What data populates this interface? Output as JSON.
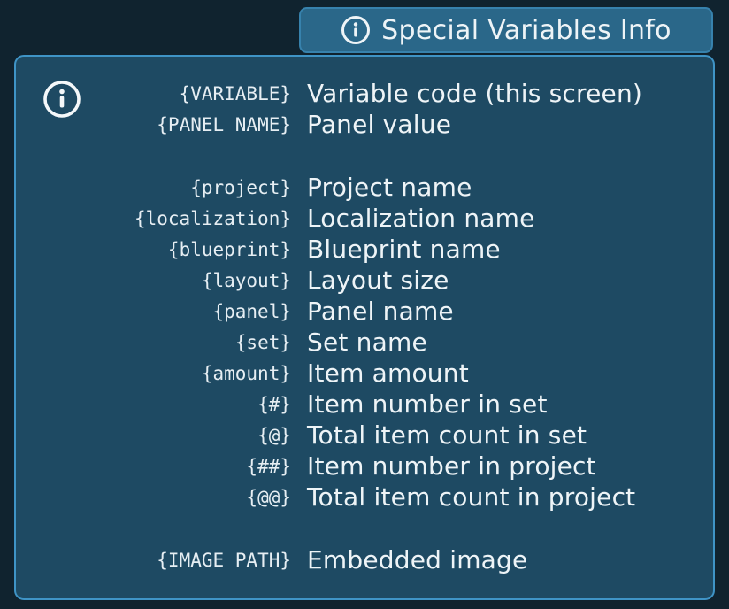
{
  "header": {
    "title": "Special Variables Info",
    "icon": "info-icon"
  },
  "panel": {
    "icon": "info-icon",
    "groups": [
      {
        "rows": [
          {
            "code": "{VARIABLE}",
            "description": "Variable code (this screen)"
          },
          {
            "code": "{PANEL NAME}",
            "description": "Panel value"
          }
        ]
      },
      {
        "rows": [
          {
            "code": "{project}",
            "description": "Project name"
          },
          {
            "code": "{localization}",
            "description": "Localization name"
          },
          {
            "code": "{blueprint}",
            "description": "Blueprint name"
          },
          {
            "code": "{layout}",
            "description": "Layout size"
          },
          {
            "code": "{panel}",
            "description": "Panel name"
          },
          {
            "code": "{set}",
            "description": "Set name"
          },
          {
            "code": "{amount}",
            "description": "Item amount"
          },
          {
            "code": "{#}",
            "description": "Item number in set"
          },
          {
            "code": "{@}",
            "description": "Total item count in set"
          },
          {
            "code": "{##}",
            "description": "Item number in project"
          },
          {
            "code": "{@@}",
            "description": "Total item count in project"
          }
        ]
      },
      {
        "rows": [
          {
            "code": "{IMAGE PATH}",
            "description": "Embedded image"
          }
        ]
      }
    ]
  },
  "colors": {
    "background": "#10232f",
    "panel": "#1e4a63",
    "panel_border": "#3f94c6",
    "header": "#2a6789",
    "text": "#eef4f7"
  }
}
